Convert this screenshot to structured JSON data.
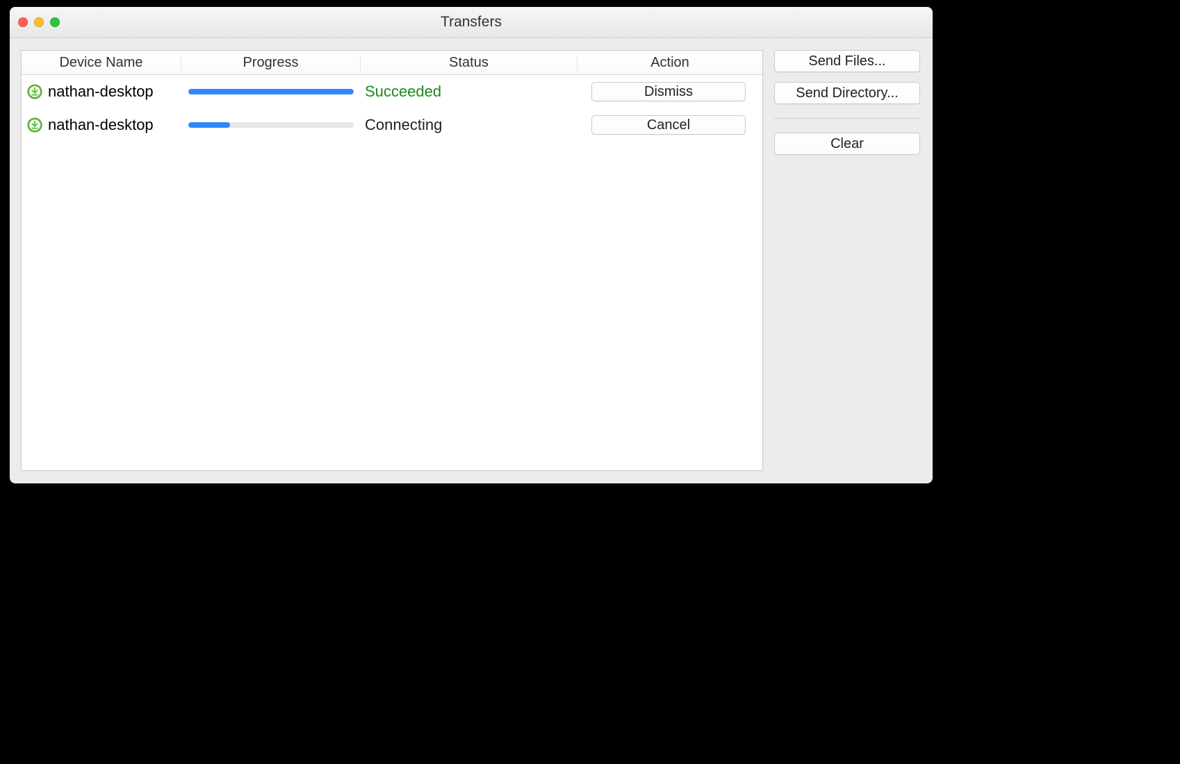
{
  "window": {
    "title": "Transfers"
  },
  "columns": {
    "device": "Device Name",
    "progress": "Progress",
    "status": "Status",
    "action": "Action"
  },
  "rows": [
    {
      "device": "nathan-desktop",
      "progress_pct": 100,
      "status": "Succeeded",
      "status_kind": "succeeded",
      "action_label": "Dismiss"
    },
    {
      "device": "nathan-desktop",
      "progress_pct": 25,
      "status": "Connecting",
      "status_kind": "connecting",
      "action_label": "Cancel"
    }
  ],
  "sidebar": {
    "send_files": "Send Files...",
    "send_directory": "Send Directory...",
    "clear": "Clear"
  },
  "icons": {
    "download": "download-icon"
  },
  "colors": {
    "progress_fill": "#2f88ff",
    "status_succeeded": "#1a8a1a"
  }
}
